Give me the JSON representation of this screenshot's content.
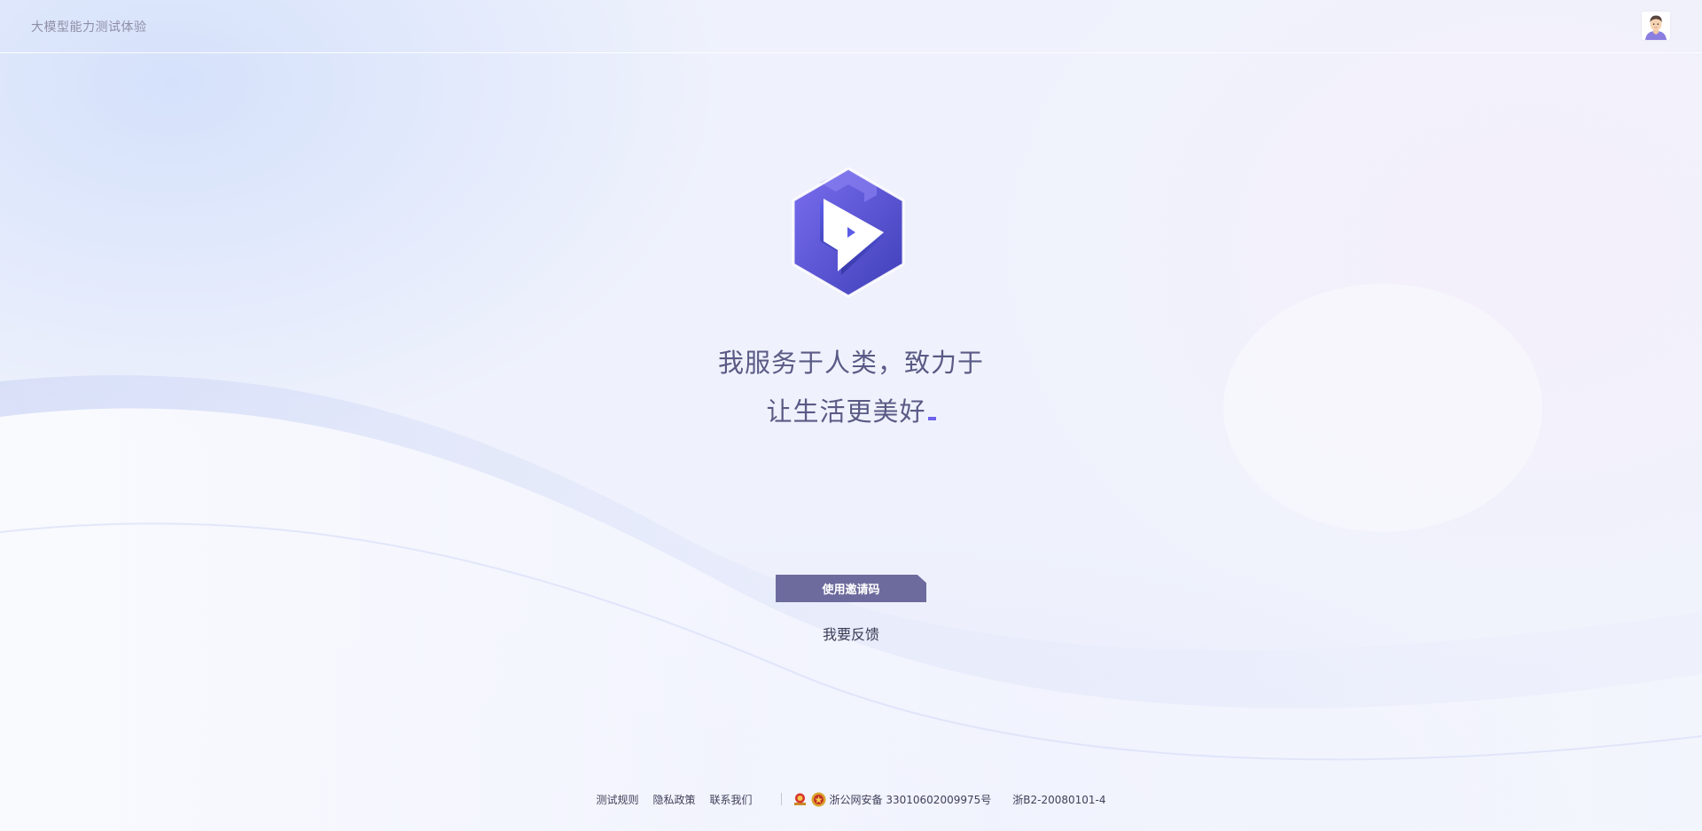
{
  "header": {
    "app_title": "大模型能力测试体验"
  },
  "hero": {
    "slogan_line1": "我服务于人类，致力于",
    "slogan_line2": "让生活更美好"
  },
  "actions": {
    "invite_button": "使用邀请码",
    "feedback_link": "我要反馈"
  },
  "footer": {
    "links": [
      "测试规则",
      "隐私政策",
      "联系我们"
    ],
    "police_record": "浙公网安备 33010602009975号",
    "icp_record": "浙B2-20080101-4"
  },
  "icons": {
    "logo": "hexagon-play-logo",
    "avatar": "user-avatar",
    "badges": [
      "license-badge-icon",
      "police-badge-icon"
    ]
  },
  "colors": {
    "brand_purple": "#5b5ce6",
    "button_bg": "#6d6b9d",
    "slogan_text": "#5a5a86",
    "cursor": "#6e62ea"
  }
}
